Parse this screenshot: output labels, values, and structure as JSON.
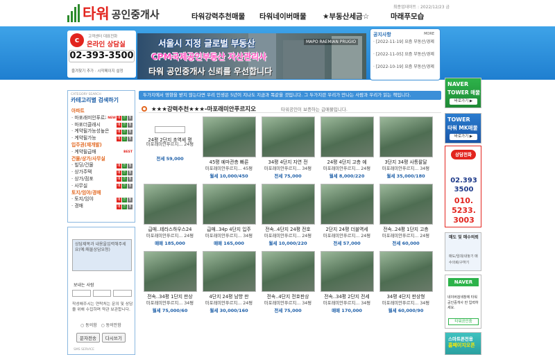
{
  "header": {
    "logo_main": "타워",
    "logo_sub": "공인중개사",
    "date": "최종업데이트 : 2022/12/23 금",
    "nav": [
      "타워강력추천매물",
      "타워네이버매물",
      "★부동산세금☆",
      "마래푸모습"
    ]
  },
  "cs": {
    "small": "고객센터 대표전화",
    "title": "온라인 상담실",
    "phone": "02-393-3500",
    "links": "즐겨찾기 추가 · 시작페이지 설정"
  },
  "hero": {
    "line1": "서울시 지정 글로벌 부동산",
    "line2": "CPM국제공인부동산 자산관리사",
    "line3": "타워 공인중개사 신뢰를 우선합니다",
    "tag": "MAPO RAEMIAN PRUGIO"
  },
  "notice": {
    "title": "공지사항",
    "more": "MORE",
    "items": [
      "· [2022-11-19] 요즘 부동산/경제",
      "· [2022-11-05] 요즘 부동산/경제",
      "· [2022-10-19] 요즘 부동산/경제"
    ]
  },
  "marquee": "두가지에서 영향을 받지 않는다면 우리 인생은 5년이 지나도 지금과 똑같을 것입니다. 그 두가지란 우리가 만나는 사람과 우리가 읽는 책입니다.",
  "category": {
    "small": "CATEGORY SEARCH",
    "title": "카테고리별 검색하기",
    "items": [
      {
        "t": "아파트",
        "grp": true
      },
      {
        "t": "· 마포래미안푸르지오",
        "badges": true,
        "new": "NEW"
      },
      {
        "t": "· 마포더클래시",
        "badges": true
      },
      {
        "t": "· 계약될가능성높은",
        "badges": true
      },
      {
        "t": "· 계약될가능",
        "badges": true
      },
      {
        "t": "입주권(재개발)",
        "grp": true
      },
      {
        "t": "· 계약될급매",
        "new": "BEST"
      },
      {
        "t": "건물/상가/사무실",
        "grp": true
      },
      {
        "t": "· 빌딩/건물",
        "badges": true
      },
      {
        "t": "· 상가주택",
        "badges": true
      },
      {
        "t": "· 상가/점포",
        "badges": true
      },
      {
        "t": "· 사무실",
        "badges": true
      },
      {
        "t": "토지/임야/경매",
        "grp": true
      },
      {
        "t": "· 토지/임야",
        "badges": true
      },
      {
        "t": "· 경매",
        "badges": true
      }
    ],
    "badge_labels": [
      "매",
      "전",
      "월"
    ]
  },
  "consult": {
    "placeholder": "상담제목과 내용을입력해주세요(예:매물상담요청)",
    "label": "보내는 사람",
    "note": "작성해주시는 연락처는 문의 및 상담을 위해 수집하며 약관 보관합니다.",
    "radio_agree": "동의함",
    "radio_disagree": "동의안함",
    "btn_send": "문자전송",
    "btn_reset": "다시쓰기",
    "svc": "SMS SERVICE"
  },
  "section": {
    "title": "★★★강력추천★★★-마포래미안푸르지오",
    "sub": "타워공인이 보증하는 급매물입니다."
  },
  "listings": [
    {
      "l1": "24평 2단지 초역세 평",
      "l2": "마포래미안푸르지... 24평",
      "l3": "전세 59,000",
      "nophoto": true
    },
    {
      "l1": "45평 예마관층 빠른",
      "l2": "마포래미안푸르지... 45평",
      "l3": "월세 10,000/450"
    },
    {
      "l1": "34평 4단지 자연 전",
      "l2": "마포래미안푸르지... 34평",
      "l3": "전세 75,000"
    },
    {
      "l1": "24평 4단지 고층 예",
      "l2": "마포래미안푸르지... 24평",
      "l3": "월세 8,000/220"
    },
    {
      "l1": "3단지 34평 사통팔달",
      "l2": "마포래미안푸르지... 34평",
      "l3": "월세 35,000/180"
    },
    {
      "l1": "급매..테라스하우스24",
      "l2": "마포래미안푸르지... 24평",
      "l3": "매매 185,000"
    },
    {
      "l1": "급매..34p 4단지 입주",
      "l2": "마포래미안푸르지... 34평",
      "l3": "매매 165,000"
    },
    {
      "l1": "전속..4단지 24평 전호",
      "l2": "마포래미안푸르지... 24평",
      "l3": "월세 10,000/220"
    },
    {
      "l1": "2단지 24평 더블역세",
      "l2": "마포래미안푸르지... 24평",
      "l3": "전세 57,000"
    },
    {
      "l1": "전속..24평 1단지 고층",
      "l2": "마포래미안푸르지... 24평",
      "l3": "전세 60,000"
    },
    {
      "l1": "전속..34평 1단지 판상",
      "l2": "마포래미안푸르지... 34평",
      "l3": "월세 75,000/60"
    },
    {
      "l1": "4단지 24평 남향 판",
      "l2": "마포래미안푸르지... 24평",
      "l3": "월세 30,000/160"
    },
    {
      "l1": "전속..4단지 전호판상",
      "l2": "마포래미안푸르지... 34평",
      "l3": "전세 75,000"
    },
    {
      "l1": "전속..34평 2단지 전세",
      "l2": "마포래미안푸르지... 34평",
      "l3": "매매 170,000"
    },
    {
      "l1": "34평 4단지 판상형",
      "l2": "마포래미안푸르지... 34평",
      "l3": "월세 60,000/90"
    }
  ],
  "rail": {
    "naver": "NAVER",
    "naver2": "TOWER 매물",
    "go": "바로가기 ▶",
    "tower": "TOWER",
    "tower2": "타워 MK매물",
    "consult_cap": "상담전화",
    "phone1": "02.393",
    "phone2": "3500",
    "phone3": "010.",
    "phone4": "5233.",
    "phone5": "3003",
    "trade_h": "매도 및 매수의뢰",
    "trade_m": "매도/임대/내놓기 매수의뢰/구하기",
    "naver_box": "NAVER",
    "naver_box_txt": "네이버검색창에 타워공인중개사 만 입력하세요.",
    "naver_box_btn": "타워공인중",
    "smart_a": "스마트폰전용",
    "smart_b": "홈페이지오픈"
  },
  "colors": {
    "brand_red": "#e2241e",
    "band_blue": "#2a8fdb",
    "accent_green": "#2db34a"
  }
}
